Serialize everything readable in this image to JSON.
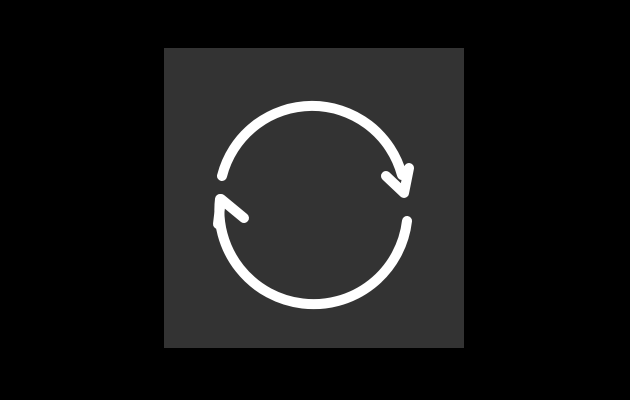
{
  "app_icon": {
    "name": "sync-app-icon",
    "icon": "sync-arrows-icon",
    "colors": {
      "background": "#000000",
      "tile": "#333333",
      "glyph": "#ffffff"
    }
  }
}
